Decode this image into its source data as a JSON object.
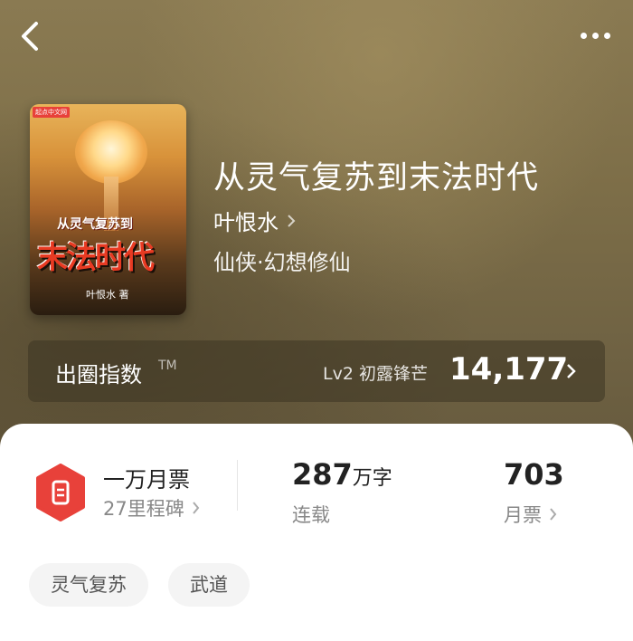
{
  "book": {
    "title": "从灵气复苏到末法时代",
    "author": "叶恨水",
    "genre": "仙侠·幻想修仙"
  },
  "cover": {
    "logo": "起点中文网",
    "title_top": "从灵气复苏到",
    "title_main": "末法时代",
    "author_line": "叶恨水 著"
  },
  "index": {
    "label": "出圈指数",
    "tm": "TM",
    "level": "Lv2 初露锋芒",
    "score": "14,177"
  },
  "stats": {
    "milestone_title": "一万月票",
    "milestone_sub": "27里程碑",
    "words_number": "287",
    "words_unit": "万字",
    "serial_status": "连载",
    "votes": "703",
    "votes_label": "月票"
  },
  "tags": [
    "灵气复苏",
    "武道"
  ],
  "colors": {
    "badge": "#e8413a",
    "text_dark": "#222222",
    "text_gray": "#888888"
  }
}
